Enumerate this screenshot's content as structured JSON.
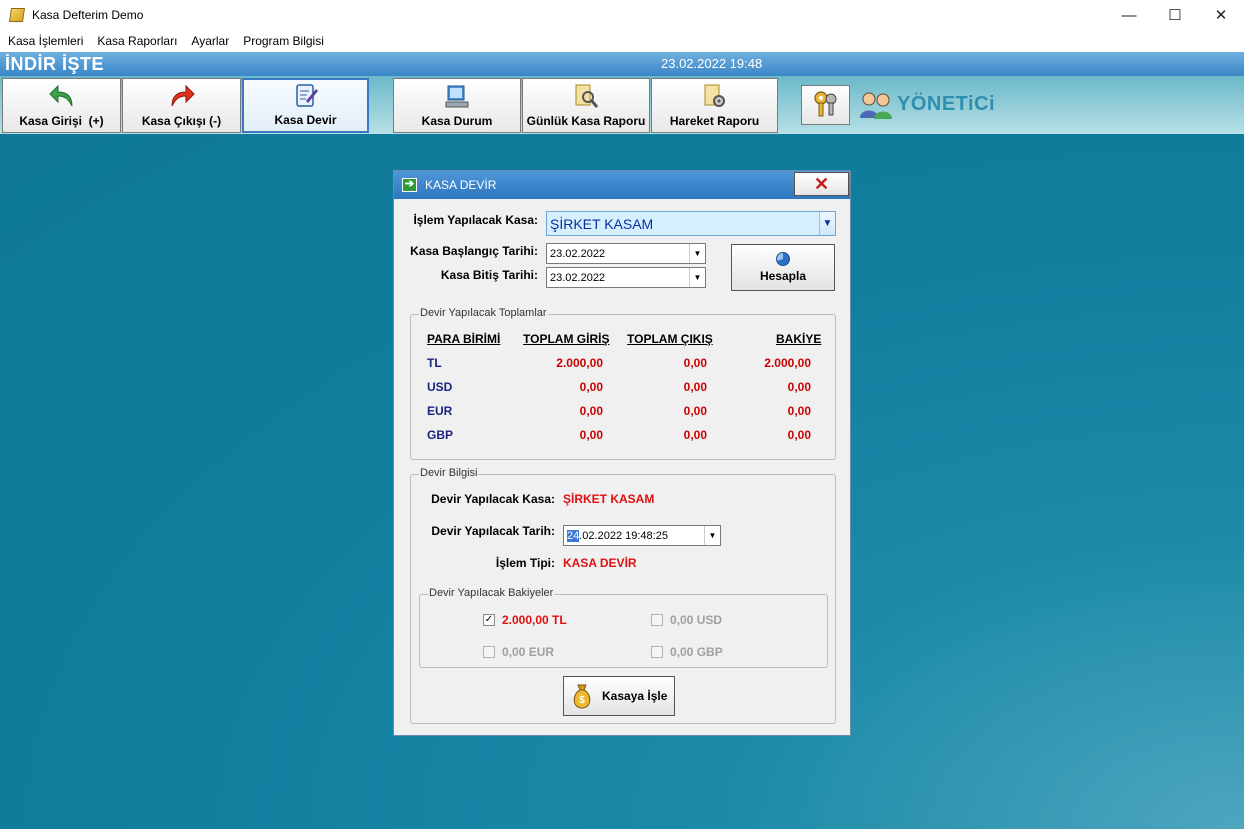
{
  "window": {
    "title": "Kasa Defterim Demo",
    "min": "—",
    "max": "☐",
    "close": "✕"
  },
  "menu": [
    "Kasa İşlemleri",
    "Kasa Raporları",
    "Ayarlar",
    "Program Bilgisi"
  ],
  "header": {
    "brand": "İNDİR İŞTE",
    "datetime": "23.02.2022 19:48"
  },
  "toolbar": {
    "kasa_girisi": "Kasa Girişi  (+)",
    "kasa_cikisi": "Kasa Çıkışı (-)",
    "kasa_devir": "Kasa Devir",
    "kasa_durum": "Kasa Durum",
    "gunluk_rapor": "Günlük Kasa Raporu",
    "hareket_raporu": "Hareket Raporu",
    "user": "YÖNETiCi"
  },
  "dialog": {
    "title": "KASA DEVİR",
    "close": "✕",
    "kasa_label": "İşlem Yapılacak Kasa:",
    "kasa_value": "ŞİRKET KASAM",
    "bas_label": "Kasa Başlangıç Tarihi:",
    "bas_value": "23.02.2022",
    "bit_label": "Kasa Bitiş Tarihi:",
    "bit_value": "23.02.2022",
    "hesapla": "Hesapla",
    "totals": {
      "legend": "Devir Yapılacak Toplamlar",
      "headers": {
        "para": "PARA BİRİMİ",
        "giris": "TOPLAM GİRİŞ",
        "cikis": "TOPLAM ÇIKIŞ",
        "bakiye": "BAKİYE"
      },
      "rows": [
        {
          "cur": "TL",
          "giris": "2.000,00",
          "cikis": "0,00",
          "bakiye": "2.000,00"
        },
        {
          "cur": "USD",
          "giris": "0,00",
          "cikis": "0,00",
          "bakiye": "0,00"
        },
        {
          "cur": "EUR",
          "giris": "0,00",
          "cikis": "0,00",
          "bakiye": "0,00"
        },
        {
          "cur": "GBP",
          "giris": "0,00",
          "cikis": "0,00",
          "bakiye": "0,00"
        }
      ]
    },
    "devir": {
      "legend": "Devir Bilgisi",
      "kasa_label": "Devir Yapılacak Kasa:",
      "kasa_value": "ŞİRKET KASAM",
      "tarih_label": "Devir Yapılacak Tarih:",
      "tarih_sel": "24",
      "tarih_rest": ".02.2022 19:48:25",
      "tip_label": "İşlem Tipi:",
      "tip_value": "KASA DEVİR"
    },
    "bakiyeler": {
      "legend": "Devir Yapılacak Bakiyeler",
      "tl": "2.000,00 TL",
      "usd": "0,00 USD",
      "eur": "0,00 EUR",
      "gbp": "0,00 GBP",
      "check": "✓"
    },
    "kasaya_isle": "Kasaya İşle"
  }
}
